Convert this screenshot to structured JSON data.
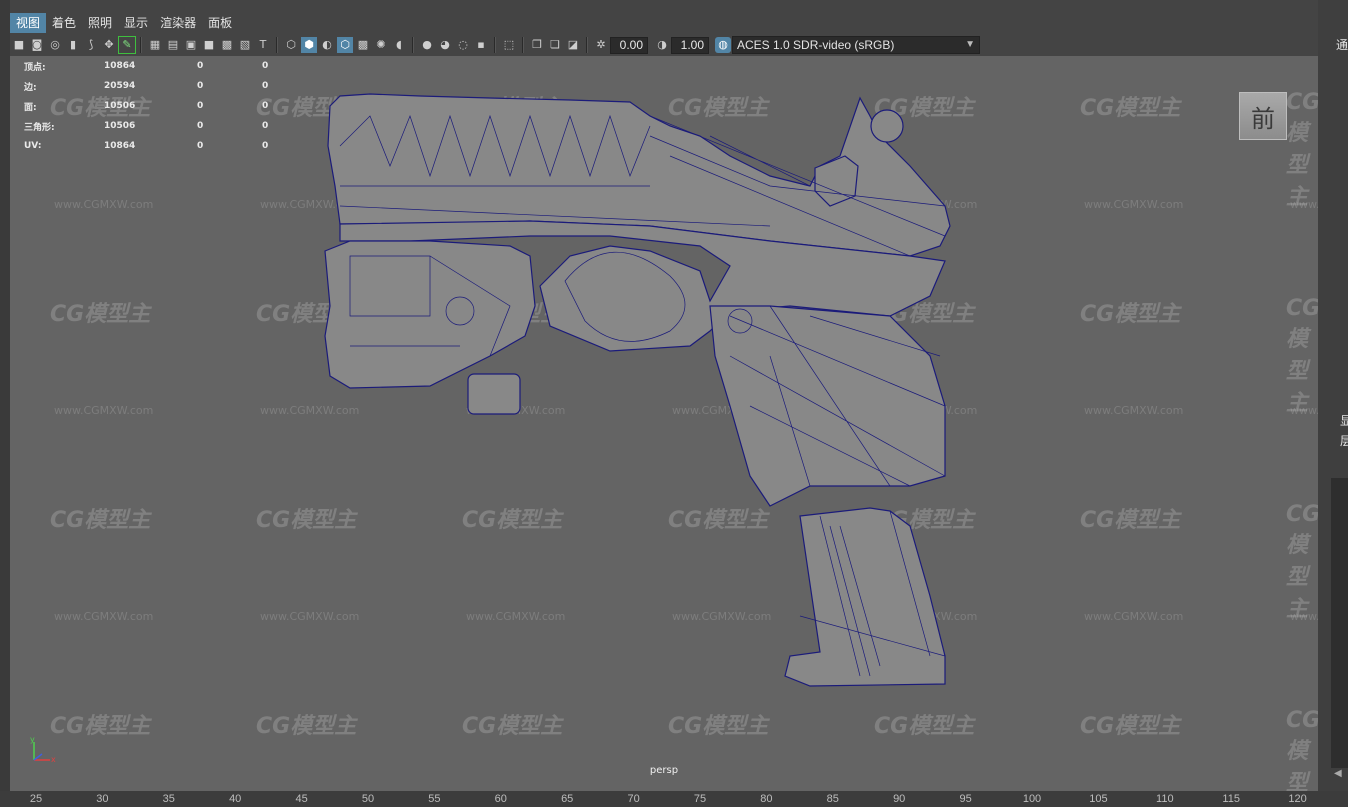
{
  "menubar": {
    "items": [
      "视图",
      "着色",
      "照明",
      "显示",
      "渲染器",
      "面板"
    ],
    "active_index": 0
  },
  "toolbar": {
    "exposure_value": "0.00",
    "gamma_value": "1.00",
    "color_space": "ACES 1.0 SDR-video (sRGB)",
    "icons": [
      "camera-icon",
      "camera-attrs-icon",
      "bookmark-icon",
      "image-plane-icon",
      "grid-icon",
      "film-gate-icon",
      "resolution-gate-icon",
      "gate-mask-icon",
      "field-chart-icon",
      "safe-action-icon",
      "safe-title-icon",
      "wireframe-icon",
      "smooth-shade-icon",
      "default-material-icon",
      "shaded-wireframe-icon",
      "textured-icon",
      "use-lights-icon",
      "shadows-icon",
      "screen-space-ao-icon",
      "motion-blur-icon",
      "anti-aliasing-icon",
      "depth-of-field-icon",
      "isolate-select-icon",
      "xray-icon",
      "xray-joints-icon",
      "backface-icon",
      "exposure-icon",
      "gamma-icon",
      "color-mgmt-icon"
    ]
  },
  "hud": {
    "rows": [
      {
        "label": "顶点:",
        "v1": "10864",
        "v2": "0",
        "v3": "0"
      },
      {
        "label": "边:",
        "v1": "20594",
        "v2": "0",
        "v3": "0"
      },
      {
        "label": "面:",
        "v1": "10506",
        "v2": "0",
        "v3": "0"
      },
      {
        "label": "三角形:",
        "v1": "10506",
        "v2": "0",
        "v3": "0"
      },
      {
        "label": "UV:",
        "v1": "10864",
        "v2": "0",
        "v3": "0"
      }
    ]
  },
  "viewport": {
    "camera": "persp",
    "view_cube_label": "前",
    "axis": {
      "x": "x",
      "y": "y"
    }
  },
  "watermark": {
    "logo": "CG模型主",
    "url": "www.CGMXW.com"
  },
  "ruler": {
    "ticks": [
      "25",
      "30",
      "35",
      "40",
      "45",
      "50",
      "55",
      "60",
      "65",
      "70",
      "75",
      "80",
      "85",
      "90",
      "95",
      "100",
      "105",
      "110",
      "115",
      "120"
    ]
  },
  "right_panel": {
    "top_text": "通",
    "mid_text_1": "显",
    "mid_text_2": "层"
  },
  "colors": {
    "viewport_bg": "#646464",
    "wire": "#1b1b7a",
    "model_fill": "#888888",
    "menu_active": "#5285a6"
  }
}
